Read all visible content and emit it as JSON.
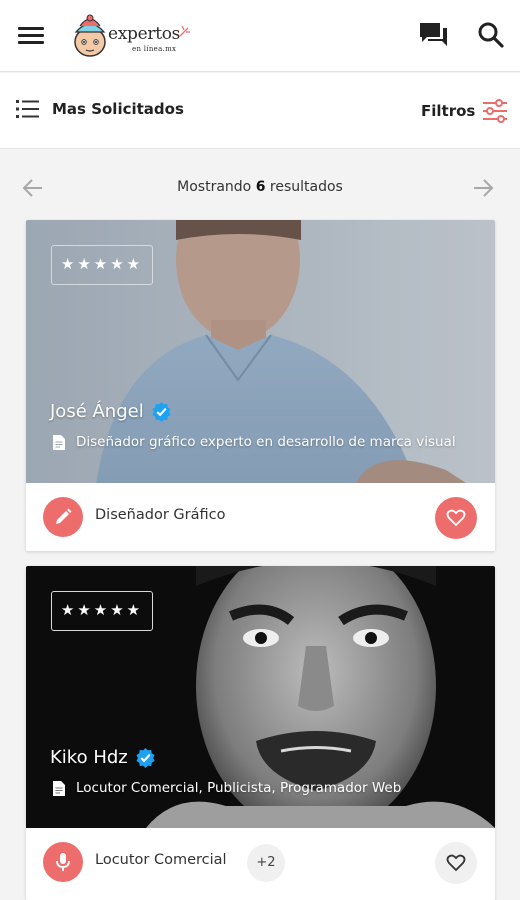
{
  "header": {
    "brand_name": "expertos",
    "brand_sub": "en línea.mx",
    "menu_icon": "hamburger-menu-icon",
    "chat_icon": "chat-bubbles-icon",
    "search_icon": "search-icon"
  },
  "toolbar": {
    "sort_label": "Mas Solicitados",
    "filter_label": "Filtros",
    "accent_color": "#ec6d6b"
  },
  "pager": {
    "prefix": "Mostrando",
    "count": "6",
    "suffix": "resultados"
  },
  "cards": [
    {
      "rating": "★★★★★",
      "name": "José Ángel",
      "verified": true,
      "description": "Diseñador gráfico experto en desarrollo de marca visual",
      "category": "Diseñador Gráfico",
      "category_icon": "pencil-icon",
      "extra_categories": "",
      "favorite": true
    },
    {
      "rating": "★★★★★",
      "name": "Kiko Hdz",
      "verified": true,
      "description": "Locutor Comercial, Publicista, Programador Web",
      "category": "Locutor Comercial",
      "category_icon": "microphone-icon",
      "extra_categories": "+2",
      "favorite": false
    }
  ]
}
